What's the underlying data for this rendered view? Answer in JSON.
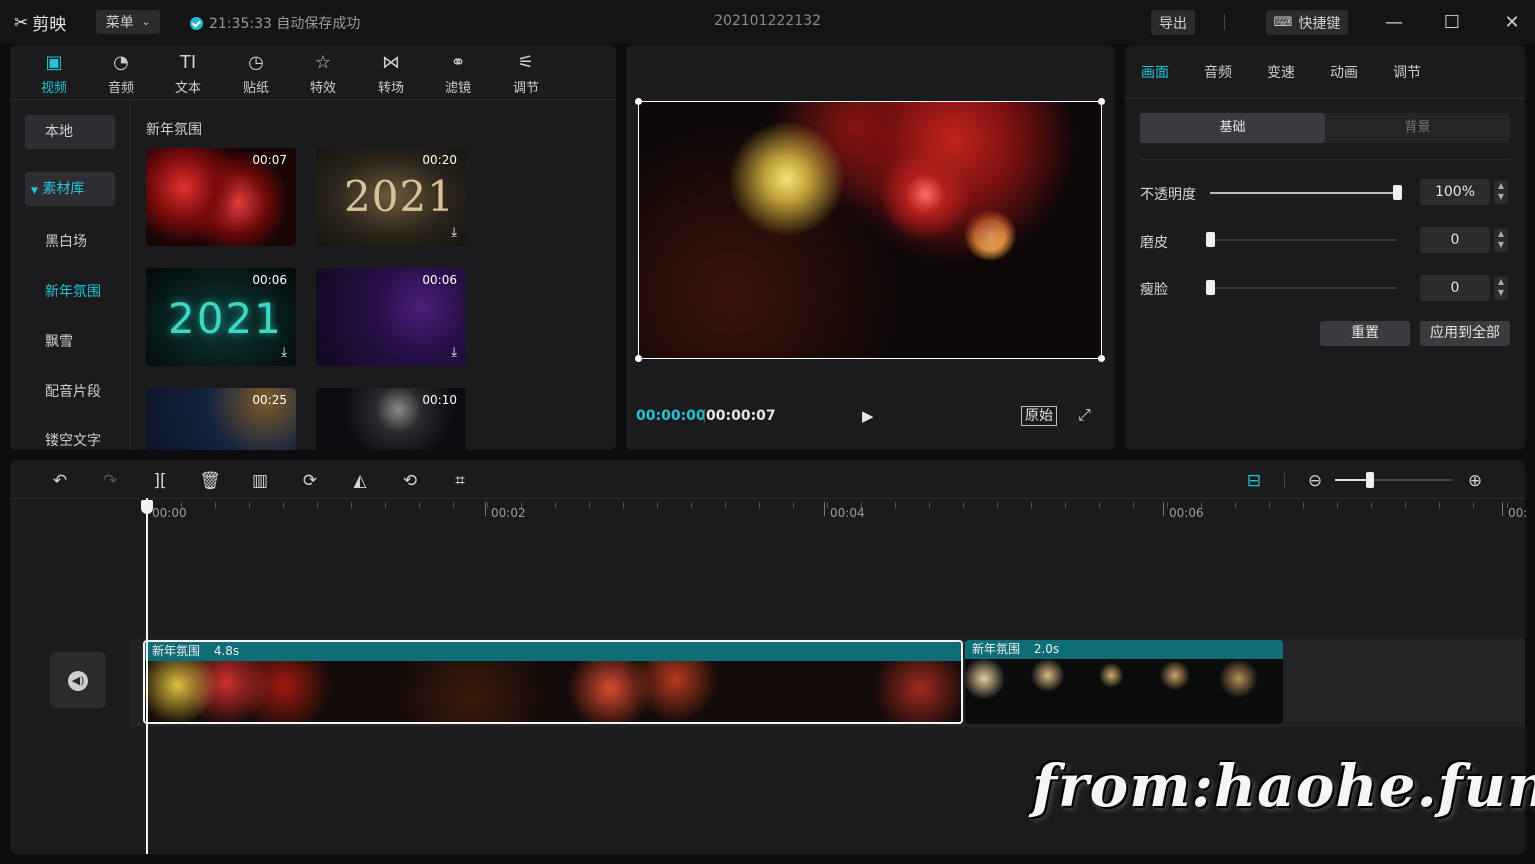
{
  "app": {
    "name": "剪映",
    "menu_label": "菜单",
    "autosave_status": "21:35:33 自动保存成功",
    "project_title": "202101222132",
    "export_label": "导出",
    "shortcuts_label": "快捷键"
  },
  "media_tabs": [
    {
      "label": "视频",
      "icon": "video-icon",
      "active": true
    },
    {
      "label": "音频",
      "icon": "audio-icon"
    },
    {
      "label": "文本",
      "icon": "text-icon"
    },
    {
      "label": "贴纸",
      "icon": "sticker-icon"
    },
    {
      "label": "特效",
      "icon": "effects-icon"
    },
    {
      "label": "转场",
      "icon": "transition-icon"
    },
    {
      "label": "滤镜",
      "icon": "filter-icon"
    },
    {
      "label": "调节",
      "icon": "adjust-icon"
    }
  ],
  "sidebar": {
    "local_label": "本地",
    "library_label": "素材库",
    "items": [
      "黑白场",
      "新年氛围",
      "飘雪",
      "配音片段",
      "镂空文字"
    ],
    "selected": "新年氛围"
  },
  "library": {
    "category_title": "新年氛围",
    "thumbnails": [
      {
        "duration": "00:07",
        "downloadable": false
      },
      {
        "duration": "00:20",
        "downloadable": true,
        "overlay_text": "2021"
      },
      {
        "duration": "00:06",
        "downloadable": true,
        "overlay_text": "2021"
      },
      {
        "duration": "00:06",
        "downloadable": true
      },
      {
        "duration": "00:25",
        "downloadable": false
      },
      {
        "duration": "00:10",
        "downloadable": false
      }
    ]
  },
  "preview": {
    "current_time": "00:00:00",
    "total_time": "00:00:07",
    "original_label": "原始"
  },
  "properties": {
    "tabs": [
      "画面",
      "音频",
      "变速",
      "动画",
      "调节"
    ],
    "active_tab": "画面",
    "segments": [
      "基础",
      "背景"
    ],
    "active_segment": "基础",
    "opacity": {
      "label": "不透明度",
      "value": "100%",
      "level": 1.0
    },
    "smooth": {
      "label": "磨皮",
      "value": "0",
      "level": 0
    },
    "thin_face": {
      "label": "瘦脸",
      "value": "0",
      "level": 0
    },
    "reset_label": "重置",
    "apply_all_label": "应用到全部"
  },
  "timeline": {
    "ruler_labels": [
      "00:00",
      "00:02",
      "00:04",
      "00:06",
      "00:"
    ],
    "zoom_level": 0.3,
    "clips": [
      {
        "name": "新年氛围",
        "duration": "4.8s"
      },
      {
        "name": "新年氛围",
        "duration": "2.0s"
      }
    ]
  },
  "watermark": "from:haohe.fun",
  "colors": {
    "accent": "#22c6d4",
    "clip_header": "#0f6d78"
  }
}
